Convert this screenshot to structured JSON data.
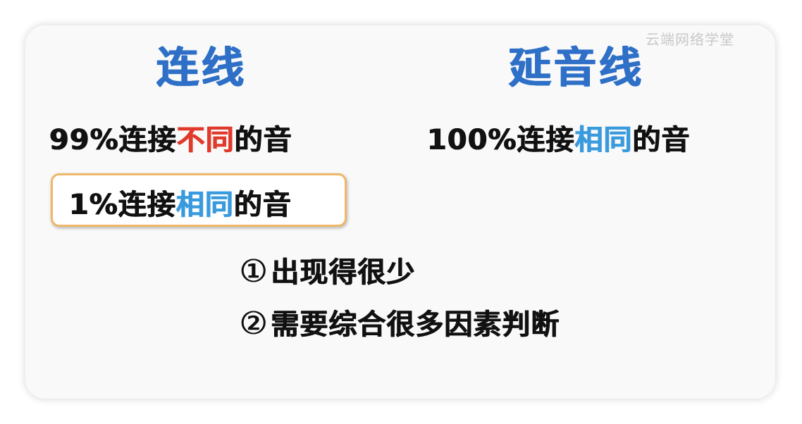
{
  "watermark": "云端网络学堂",
  "left_heading": "连线",
  "right_heading": "延音线",
  "line1": {
    "prefix": "99%连接",
    "highlight": "不同",
    "suffix": "的音"
  },
  "line2": {
    "prefix": "100%连接",
    "highlight": "相同",
    "suffix": "的音"
  },
  "box_line": {
    "prefix": "1%连接",
    "highlight": "相同",
    "suffix": "的音"
  },
  "point1": {
    "num": "①",
    "text": "出现得很少"
  },
  "point2": {
    "num": "②",
    "text": "需要综合很多因素判断"
  },
  "colors": {
    "heading": "#2e6fc7",
    "highlight_red": "#e03a2c",
    "highlight_blue": "#3a9ade",
    "box_border": "#f0b768"
  }
}
